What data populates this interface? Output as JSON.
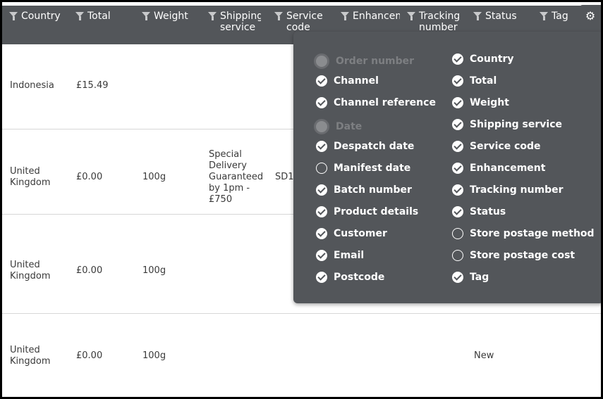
{
  "columns": [
    {
      "label": "Country"
    },
    {
      "label": "Total"
    },
    {
      "label": "Weight"
    },
    {
      "label": "Shipping service"
    },
    {
      "label": "Service code"
    },
    {
      "label": "Enhancement"
    },
    {
      "label": "Tracking number"
    },
    {
      "label": "Status"
    },
    {
      "label": "Tag"
    }
  ],
  "settings_icon": "gear-icon",
  "rows": [
    {
      "country": "Indonesia",
      "total": "£15.49",
      "weight": "",
      "shipping_service": "",
      "service_code": "",
      "status": ""
    },
    {
      "country": "United Kingdom",
      "total": "£0.00",
      "weight": "100g",
      "shipping_service": "Special Delivery Guaranteed by 1pm - £750",
      "service_code": "SD1",
      "status": ""
    },
    {
      "country": "United Kingdom",
      "total": "£0.00",
      "weight": "100g",
      "shipping_service": "",
      "service_code": "",
      "status": ""
    },
    {
      "country": "United Kingdom",
      "total": "£0.00",
      "weight": "100g",
      "shipping_service": "",
      "service_code": "",
      "status": "New"
    }
  ],
  "column_options": {
    "left": [
      {
        "label": "Order number",
        "state": "disabled"
      },
      {
        "label": "Channel",
        "state": "checked"
      },
      {
        "label": "Channel reference",
        "state": "checked"
      },
      {
        "label": "Date",
        "state": "disabled"
      },
      {
        "label": "Despatch date",
        "state": "checked"
      },
      {
        "label": "Manifest date",
        "state": "unchecked"
      },
      {
        "label": "Batch number",
        "state": "checked"
      },
      {
        "label": "Product details",
        "state": "checked"
      },
      {
        "label": "Customer",
        "state": "checked"
      },
      {
        "label": "Email",
        "state": "checked"
      },
      {
        "label": "Postcode",
        "state": "checked"
      }
    ],
    "right": [
      {
        "label": "Country",
        "state": "checked"
      },
      {
        "label": "Total",
        "state": "checked"
      },
      {
        "label": "Weight",
        "state": "checked"
      },
      {
        "label": "Shipping service",
        "state": "checked"
      },
      {
        "label": "Service code",
        "state": "checked"
      },
      {
        "label": "Enhancement",
        "state": "checked"
      },
      {
        "label": "Tracking number",
        "state": "checked"
      },
      {
        "label": "Status",
        "state": "checked"
      },
      {
        "label": "Store postage method",
        "state": "unchecked"
      },
      {
        "label": "Store postage cost",
        "state": "unchecked"
      },
      {
        "label": "Tag",
        "state": "checked"
      }
    ]
  }
}
